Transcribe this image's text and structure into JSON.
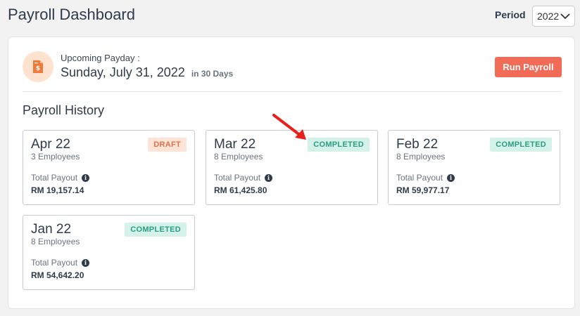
{
  "header": {
    "title": "Payroll Dashboard",
    "period_label": "Period",
    "period_value": "2022"
  },
  "payday": {
    "caption": "Upcoming Payday :",
    "date": "Sunday, July 31, 2022",
    "days": "in 30 Days",
    "icon": "document-dollar-icon",
    "run_label": "Run Payroll"
  },
  "history": {
    "title": "Payroll History",
    "payout_label": "Total Payout",
    "cards": [
      {
        "month": "Apr 22",
        "employees": "3 Employees",
        "status": "DRAFT",
        "amount": "RM 19,157.14"
      },
      {
        "month": "Mar 22",
        "employees": "8 Employees",
        "status": "COMPLETED",
        "amount": "RM 61,425.80"
      },
      {
        "month": "Feb 22",
        "employees": "8 Employees",
        "status": "COMPLETED",
        "amount": "RM 59,977.17"
      },
      {
        "month": "Jan 22",
        "employees": "8 Employees",
        "status": "COMPLETED",
        "amount": "RM 54,642.20"
      }
    ]
  },
  "colors": {
    "accent": "#f26b57",
    "draft_bg": "#fde4d6",
    "completed_bg": "#d4f2ea",
    "annotation_arrow": "#e8201c"
  }
}
